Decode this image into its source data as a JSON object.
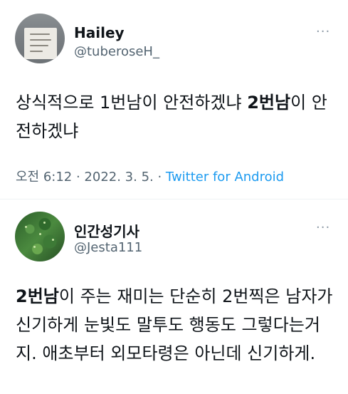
{
  "tweets": [
    {
      "display_name": "Hailey",
      "handle": "@tuberoseH_",
      "more_label": "···",
      "text_plain_1": "상식적으로 1번남이 안전하겠냐 ",
      "text_bold_1": "2번남",
      "text_plain_2": "이 안전하겠냐",
      "timestamp": "오전 6:12 · 2022. 3. 5.",
      "separator": " · ",
      "source": "Twitter for Android"
    },
    {
      "display_name": "인간성기사",
      "handle": "@Jesta111",
      "more_label": "···",
      "text_bold_1": "2번남",
      "text_plain_1": "이 주는 재미는 단순히 2번찍은 남자가 신기하게 눈빛도 말투도 행동도 그렇다는거지. 애초부터 외모타령은 아닌데 신기하게."
    }
  ],
  "colors": {
    "text": "#0f1419",
    "secondary": "#536471",
    "link": "#1d9bf0",
    "divider": "#eff3f4"
  }
}
